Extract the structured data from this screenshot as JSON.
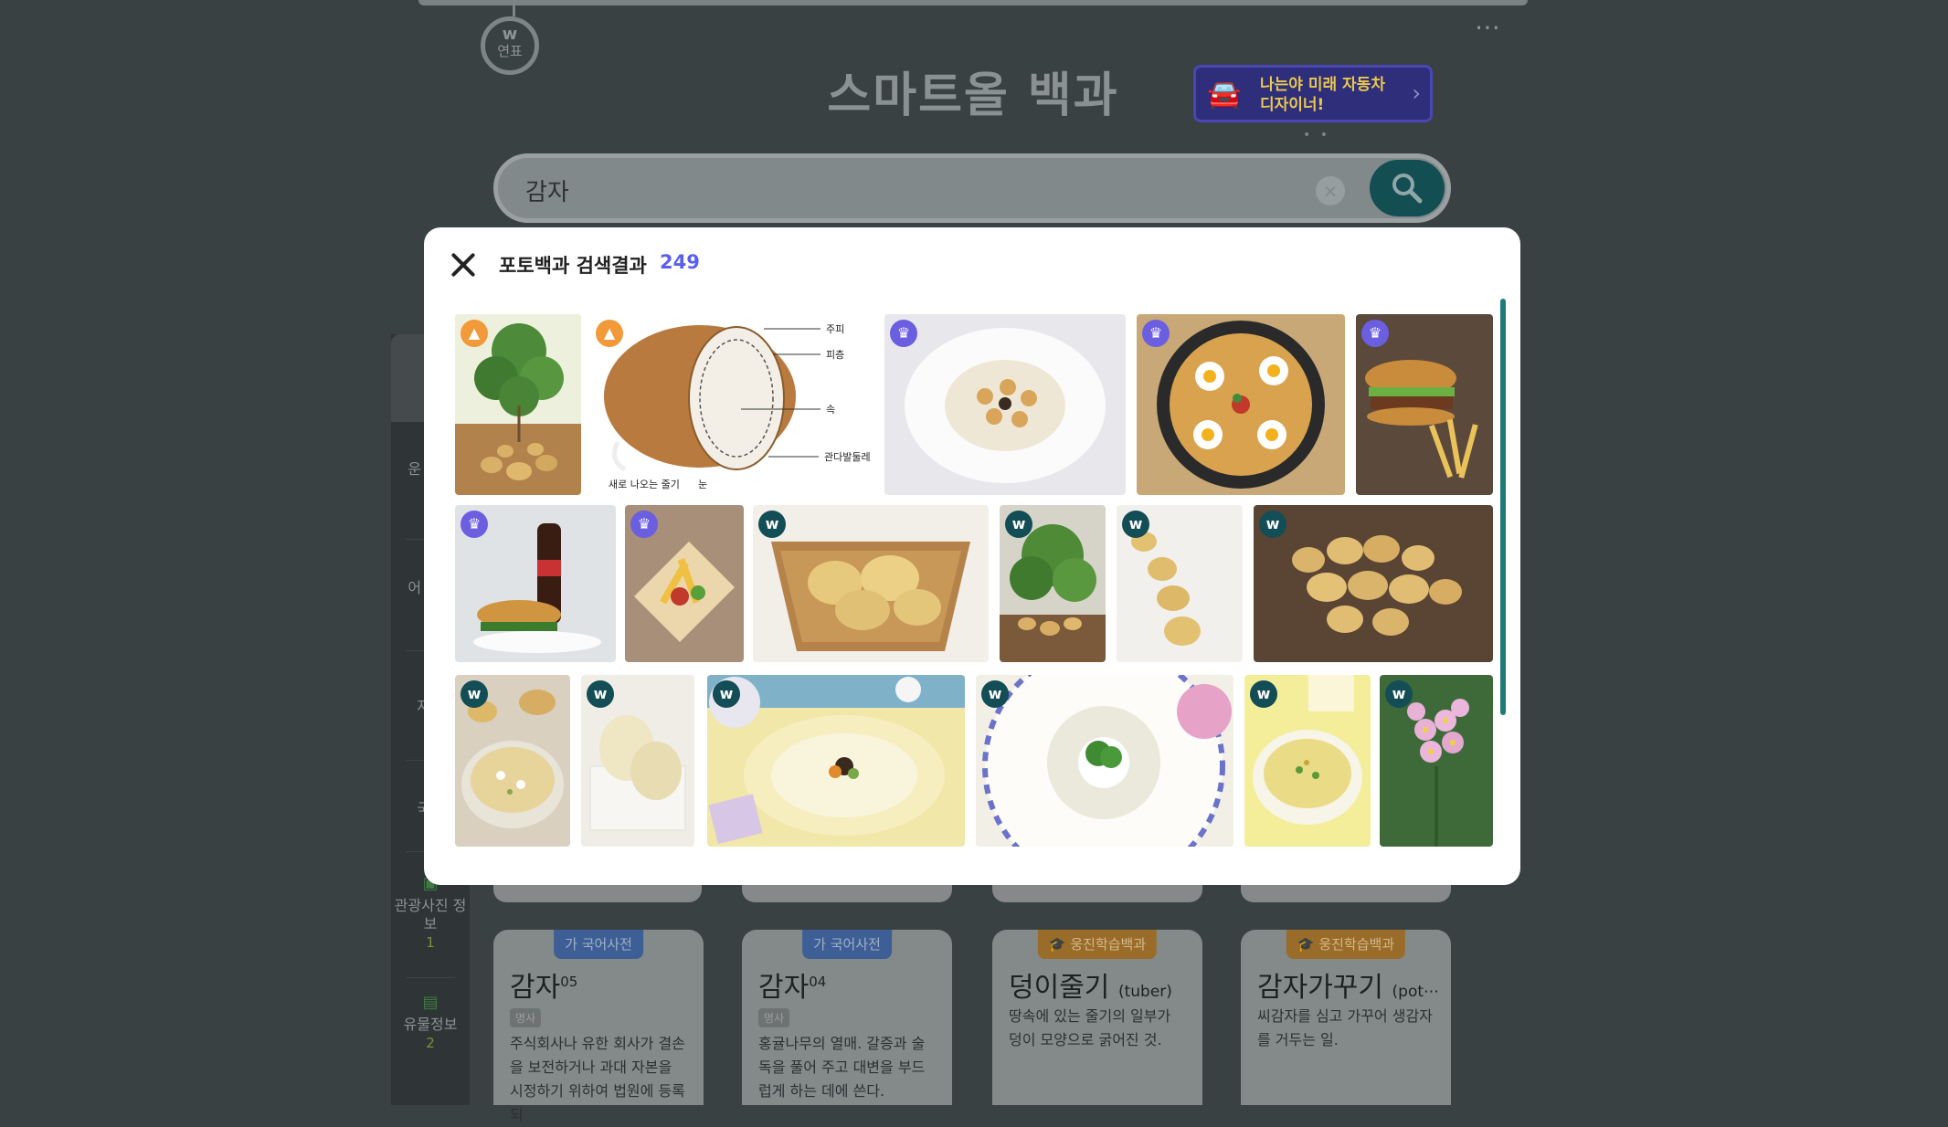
{
  "header": {
    "year_button_logo": "w",
    "year_button_label": "연표",
    "more_icon": "⋯",
    "site_title": "스마트올 백과",
    "banner_text": "나는야 미래 자동차 디자이너!",
    "banner_chevron": "›",
    "carousel_dots": "• •"
  },
  "search": {
    "value": "감자",
    "clear_icon": "×",
    "search_icon": "⚲"
  },
  "sidebar": {
    "items": [
      {
        "label": "운 학습",
        "count": ""
      },
      {
        "label": "어 생물",
        "count": ""
      },
      {
        "label": "자연",
        "count": ""
      },
      {
        "label": "국어",
        "count": ""
      },
      {
        "label": "관광사진 정보",
        "count": "1"
      },
      {
        "label": "유물정보",
        "count": "2"
      }
    ]
  },
  "cards": [
    {
      "tag": "국어사전",
      "tag_icon": "가",
      "title": "감자",
      "sup": "05",
      "note": "",
      "pos": "명사",
      "desc": "주식회사나 유한 회사가 결손을 보전하거나 과대 자본을 시정하기 위하여 법원에 등록되"
    },
    {
      "tag": "국어사전",
      "tag_icon": "가",
      "title": "감자",
      "sup": "04",
      "note": "",
      "pos": "명사",
      "desc": "홍귤나무의 열매. 갈증과 술독을 풀어 주고 대변을 부드럽게 하는 데에 쓴다."
    },
    {
      "tag": "웅진학습백과",
      "tag_icon": "🎓",
      "title": "덩이줄기",
      "sup": "",
      "note": "(tuber)",
      "pos": "",
      "desc": "땅속에 있는 줄기의 일부가 덩이 모양으로 굵어진 것."
    },
    {
      "tag": "웅진학습백과",
      "tag_icon": "🎓",
      "title": "감자가꾸기",
      "sup": "",
      "note": "(pot⋯",
      "pos": "",
      "desc": "씨감자를 심고 가꾸어 생감자를 거두는 일."
    }
  ],
  "modal": {
    "close_icon": "×",
    "title": "포토백과 검색결과",
    "count": "249",
    "diagram_labels": {
      "skin": "주피",
      "cortex": "피층",
      "core": "속",
      "vascular": "관다발둘레",
      "sprout": "새로 나오는 줄기",
      "eye": "눈"
    },
    "photos": [
      {
        "name": "potato-plant-illustration",
        "badge": "edu",
        "badge_icon": "mortarboard-icon"
      },
      {
        "name": "potato-cross-section-diagram",
        "badge": "edu",
        "badge_icon": "mortarboard-icon"
      },
      {
        "name": "potato-gnocchi-plate",
        "badge": "premium",
        "badge_icon": "crown-icon"
      },
      {
        "name": "potato-pizza",
        "badge": "premium",
        "badge_icon": "crown-icon"
      },
      {
        "name": "burger-and-fries",
        "badge": "premium",
        "badge_icon": "crown-icon"
      },
      {
        "name": "burger-set-with-cola",
        "badge": "premium",
        "badge_icon": "crown-icon"
      },
      {
        "name": "tortilla-wrap-fries",
        "badge": "premium",
        "badge_icon": "crown-icon"
      },
      {
        "name": "potatoes-in-basket",
        "badge": "w",
        "badge_icon": "w-logo-icon"
      },
      {
        "name": "potato-plant-soil",
        "badge": "w",
        "badge_icon": "w-logo-icon"
      },
      {
        "name": "potatoes-in-a-row",
        "badge": "w",
        "badge_icon": "w-logo-icon"
      },
      {
        "name": "potato-pile-on-soil",
        "badge": "w",
        "badge_icon": "w-logo-icon"
      },
      {
        "name": "potato-soup-bowl",
        "badge": "w",
        "badge_icon": "w-logo-icon"
      },
      {
        "name": "peeled-potatoes",
        "badge": "w",
        "badge_icon": "w-logo-icon"
      },
      {
        "name": "potato-noodle-bowl",
        "badge": "w",
        "badge_icon": "w-logo-icon"
      },
      {
        "name": "potato-rice-ring-with-broccoli",
        "badge": "w",
        "badge_icon": "w-logo-icon"
      },
      {
        "name": "potato-cream-soup",
        "badge": "w",
        "badge_icon": "w-logo-icon"
      },
      {
        "name": "potato-flower",
        "badge": "w",
        "badge_icon": "w-logo-icon"
      }
    ]
  },
  "colors": {
    "accent_count": "#5b5ff0",
    "badge_edu": "#f29a3a",
    "badge_premium": "#6b5fe0",
    "badge_w": "#134d55",
    "scroll_thumb": "#207a7a"
  }
}
